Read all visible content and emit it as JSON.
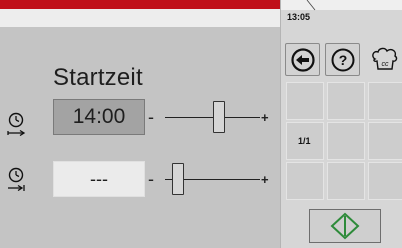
{
  "status": {
    "clock": "13:05"
  },
  "start_time_panel": {
    "title": "Startzeit",
    "start_row": {
      "value": "14:00",
      "minus": "-",
      "plus": "+",
      "slider_level": 0.58
    },
    "end_row": {
      "value": "---",
      "minus": "-",
      "plus": "+",
      "slider_level": 0.08
    }
  },
  "sidebar": {
    "toolbar": {
      "back_icon": "back-arrow-icon",
      "help_icon": "question-icon",
      "chef_icon": "chef-hat-icon"
    },
    "grid_cell_label": "1/1",
    "start_button_icon": "start-diamond-icon"
  },
  "colors": {
    "accent_red": "#c0101a",
    "start_green": "#2e8b3a"
  }
}
